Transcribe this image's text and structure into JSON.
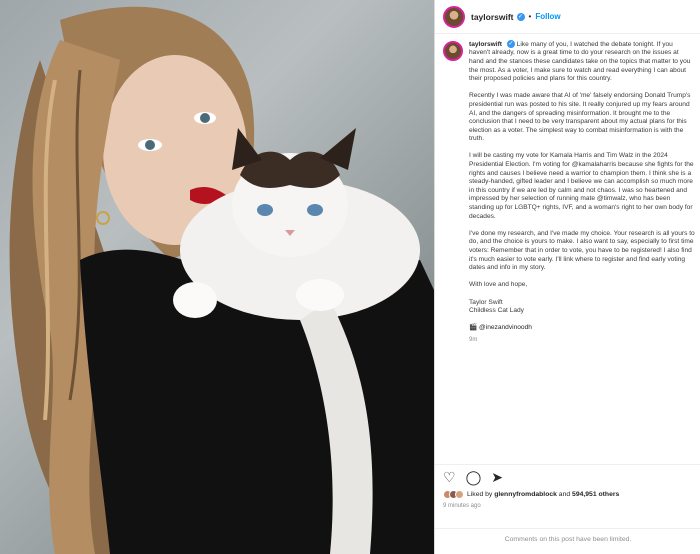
{
  "post": {
    "username": "taylorswift",
    "follow_label": "Follow",
    "separator": "•",
    "caption_paragraphs": [
      "Like many of you, I watched the debate tonight. If you haven't already, now is a great time to do your research on the issues at hand and the stances these candidates take on the topics that matter to you the most. As a voter, I make sure to watch and read everything I can about their proposed policies and plans for this country.",
      "Recently I was made aware that AI of 'me' falsely endorsing Donald Trump's presidential run was posted to his site. It really conjured up my fears around AI, and the dangers of spreading misinformation. It brought me to the conclusion that I need to be very transparent about my actual plans for this election as a voter. The simplest way to combat misinformation is with the truth.",
      "I will be casting my vote for Kamala Harris and Tim Walz in the 2024 Presidential Election. I'm voting for @kamalaharris because she fights for the rights and causes I believe need a warrior to champion them. I think she is a steady-handed, gifted leader and I believe we can accomplish so much more in this country if we are led by calm and not chaos. I was so heartened and impressed by her selection of running mate @timwalz, who has been standing up for LGBTQ+ rights, IVF, and a woman's right to her own body for decades.",
      "I've done my research, and I've made my choice. Your research is all yours to do, and the choice is yours to make. I also want to say, especially to first time voters: Remember that in order to vote, you have to be registered! I also find it's much easier to vote early. I'll link where to register and find early voting dates and info in my story.",
      "With love and hope,"
    ],
    "signature_name": "Taylor Swift",
    "signature_title": "Childless Cat Lady",
    "photo_credit": "🎬 @inezandvinoodh",
    "caption_time": "9m",
    "likes_prefix": "Liked by ",
    "likes_user": "glennyfromdablock",
    "likes_and": " and ",
    "likes_count": "594,951 others",
    "time_ago": "9 minutes ago",
    "comments_off": "Comments on this post have been limited."
  },
  "icons": {
    "like": "heart-icon",
    "comment": "comment-icon",
    "share": "share-icon",
    "verified": "verified-badge-icon"
  },
  "colors": {
    "follow_blue": "#0095f6",
    "verified_blue": "#3897f0"
  }
}
